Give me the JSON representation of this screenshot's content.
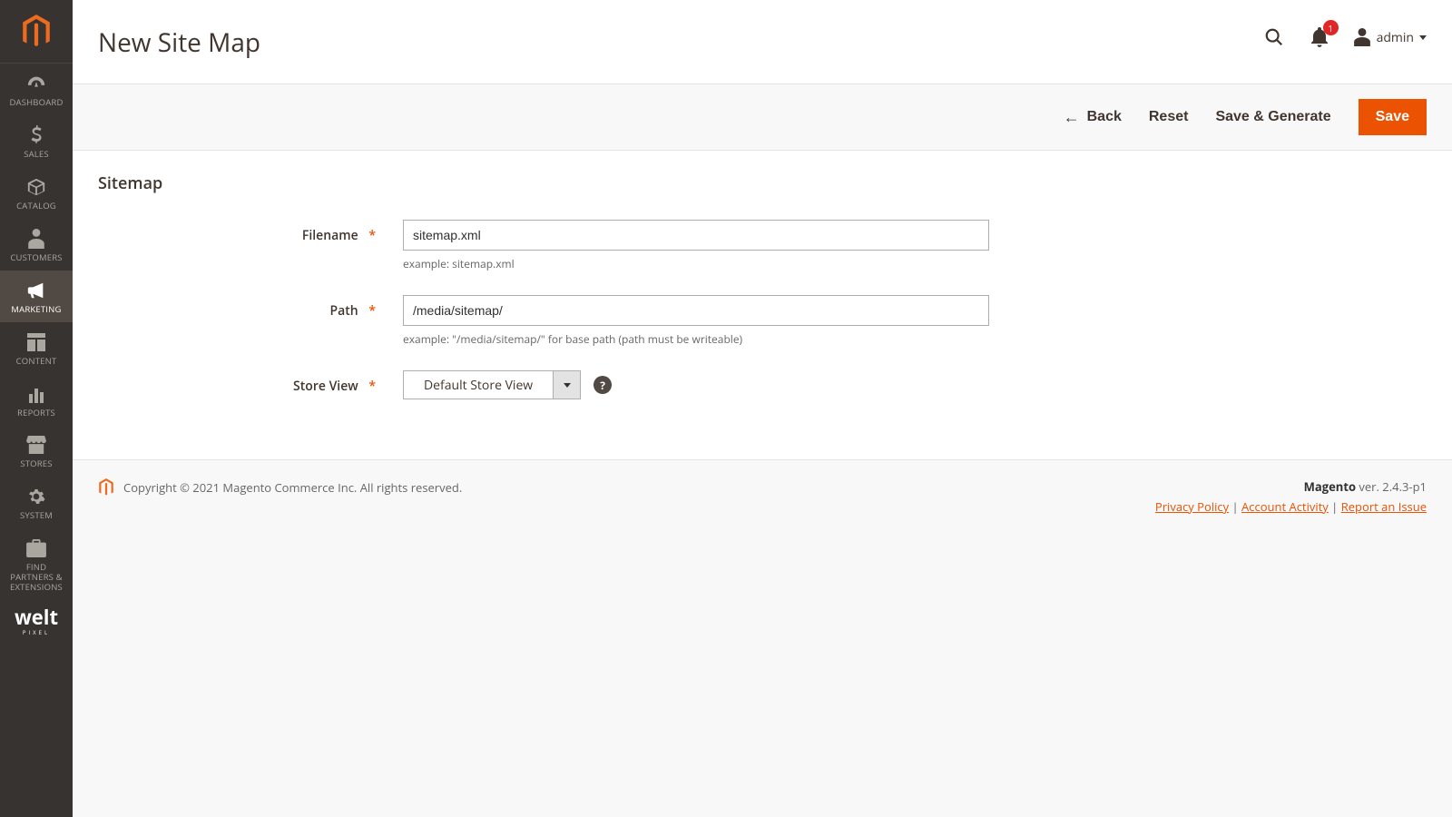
{
  "sidebar": {
    "items": [
      {
        "label": "DASHBOARD"
      },
      {
        "label": "SALES"
      },
      {
        "label": "CATALOG"
      },
      {
        "label": "CUSTOMERS"
      },
      {
        "label": "MARKETING"
      },
      {
        "label": "CONTENT"
      },
      {
        "label": "REPORTS"
      },
      {
        "label": "STORES"
      },
      {
        "label": "SYSTEM"
      },
      {
        "label": "FIND PARTNERS & EXTENSIONS"
      }
    ],
    "secondary_brand": "welt",
    "secondary_brand_sub": "PIXEL"
  },
  "header": {
    "title": "New Site Map",
    "notification_count": "1",
    "username": "admin"
  },
  "actions": {
    "back": "Back",
    "reset": "Reset",
    "save_generate": "Save & Generate",
    "save": "Save"
  },
  "section_title": "Sitemap",
  "fields": {
    "filename": {
      "label": "Filename",
      "value": "sitemap.xml",
      "hint": "example: sitemap.xml"
    },
    "path": {
      "label": "Path",
      "value": "/media/sitemap/",
      "hint": "example: \"/media/sitemap/\" for base path (path must be writeable)"
    },
    "store_view": {
      "label": "Store View",
      "value": "Default Store View"
    }
  },
  "footer": {
    "copyright": "Copyright © 2021 Magento Commerce Inc. All rights reserved.",
    "product": "Magento",
    "version": " ver. 2.4.3-p1",
    "privacy": "Privacy Policy",
    "activity": " Account Activity",
    "issue": "Report an Issue"
  }
}
